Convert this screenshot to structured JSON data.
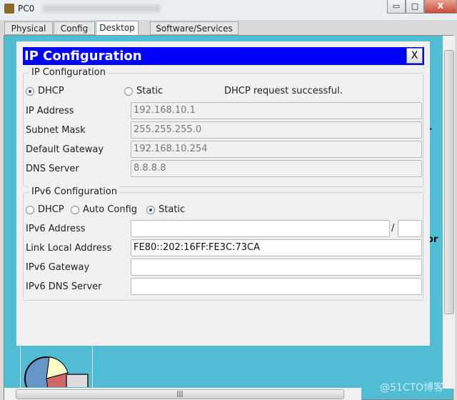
{
  "window": {
    "title": "PC0",
    "minimize": "▭",
    "maximize": "□",
    "close": "X"
  },
  "tabs": [
    {
      "label": "Physical"
    },
    {
      "label": "Config"
    },
    {
      "label": "Desktop",
      "active": true
    },
    {
      "label": "Software/Services"
    }
  ],
  "dialog": {
    "title": "IP Configuration",
    "close_label": "X",
    "ipv4": {
      "legend": "IP Configuration",
      "dhcp_label": "DHCP",
      "static_label": "Static",
      "mode": "DHCP",
      "status": "DHCP request successful.",
      "fields": [
        {
          "label": "IP Address",
          "value": "192.168.10.1"
        },
        {
          "label": "Subnet Mask",
          "value": "255.255.255.0"
        },
        {
          "label": "Default Gateway",
          "value": "192.168.10.254"
        },
        {
          "label": "DNS Server",
          "value": "8.8.8.8"
        }
      ]
    },
    "ipv6": {
      "legend": "IPv6 Configuration",
      "dhcp_label": "DHCP",
      "auto_label": "Auto Config",
      "static_label": "Static",
      "mode": "Static",
      "prefix_sep": "/",
      "fields": [
        {
          "label": "IPv6 Address",
          "value": "",
          "prefix": ""
        },
        {
          "label": "Link Local Address",
          "value": "FE80::202:16FF:FE3C:73CA"
        },
        {
          "label": "IPv6 Gateway",
          "value": ""
        },
        {
          "label": "IPv6 DNS Server",
          "value": ""
        }
      ]
    }
  },
  "background_fragments": {
    "a": "r",
    "b": "or"
  },
  "watermark": "@51CTO博客"
}
